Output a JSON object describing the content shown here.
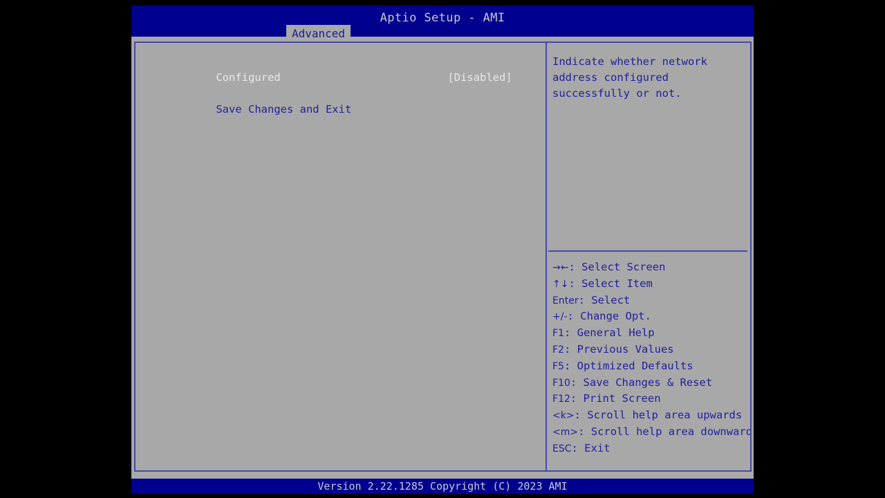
{
  "header": {
    "title": "Aptio Setup - AMI",
    "tabs": [
      {
        "label": "Advanced",
        "active": true
      }
    ]
  },
  "main": {
    "settings": [
      {
        "label": "Configured",
        "value": "[Disabled]",
        "type": "option"
      },
      {
        "label": "Save Changes and Exit",
        "value": "",
        "type": "action"
      }
    ]
  },
  "help": {
    "description": "Indicate whether network\naddress configured\nsuccessfully or not.",
    "legend": [
      {
        "key": "→←",
        "text": ": Select Screen"
      },
      {
        "key": "↑↓",
        "text": ": Select Item"
      },
      {
        "key": "Enter",
        "text": ": Select"
      },
      {
        "key": "+/-",
        "text": ": Change Opt."
      },
      {
        "key": "F1",
        "text": ": General Help"
      },
      {
        "key": "F2",
        "text": ": Previous Values"
      },
      {
        "key": "F5",
        "text": ": Optimized Defaults"
      },
      {
        "key": "F10",
        "text": ": Save Changes & Reset"
      },
      {
        "key": "F12",
        "text": ": Print Screen"
      },
      {
        "key": "<k>",
        "text": ": Scroll help area upwards"
      },
      {
        "key": "<m>",
        "text": ": Scroll help area downwards"
      },
      {
        "key": "ESC",
        "text": ": Exit"
      }
    ]
  },
  "footer": {
    "version": "Version 2.22.1285 Copyright (C) 2023 AMI"
  },
  "colors": {
    "screen_bg": "#a8a8a8",
    "header_blue": "#00008f",
    "border_blue": "#4646b4",
    "text_blue": "#2020a0",
    "text_white": "#e8e8e8",
    "title_text": "#c8c8d8"
  }
}
